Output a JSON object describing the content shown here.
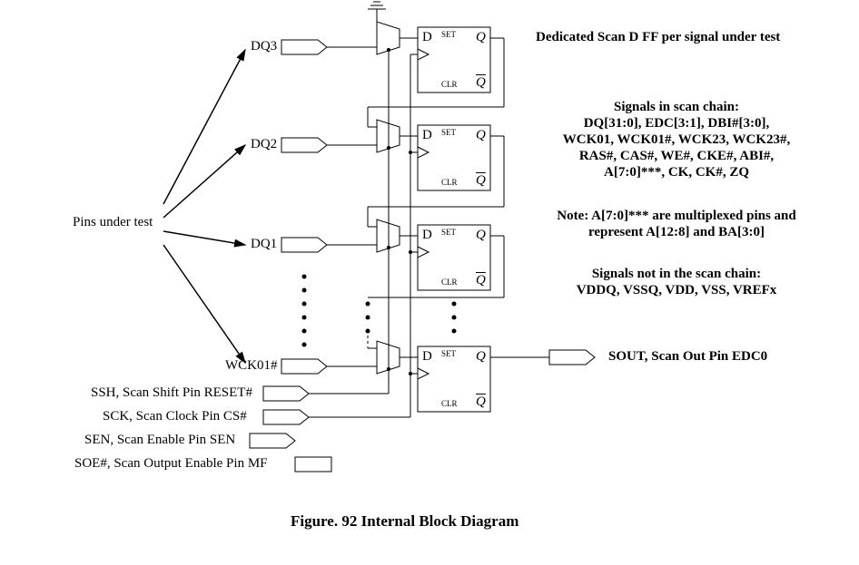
{
  "pins": {
    "dq3": "DQ3",
    "dq2": "DQ2",
    "dq1": "DQ1",
    "wck01": "WCK01#"
  },
  "left_label": "Pins under test",
  "ff": {
    "d": "D",
    "set": "SET",
    "q": "Q",
    "clr": "CLR",
    "qbar": "Q"
  },
  "right": {
    "title1": "Dedicated Scan D FF per signal under test",
    "title2": "Signals in scan chain:",
    "line1": "DQ[31:0], EDC[3:1], DBI#[3:0],",
    "line2": "WCK01, WCK01#, WCK23, WCK23#,",
    "line3": "RAS#, CAS#, WE#, CKE#, ABI#,",
    "line4": "A[7:0]***, CK, CK#, ZQ",
    "note1": "Note: A[7:0]*** are multiplexed pins and",
    "note2": "represent A[12:8] and BA[3:0]",
    "title3": "Signals not in the scan chain:",
    "line5": "VDDQ, VSSQ, VDD, VSS, VREFx",
    "sout": "SOUT, Scan Out Pin EDC0"
  },
  "ctrl": {
    "ssh": "SSH, Scan Shift Pin RESET#",
    "sck": "SCK, Scan Clock Pin CS#",
    "sen": "SEN, Scan Enable Pin SEN",
    "soe": "SOE#, Scan Output Enable Pin MF"
  },
  "caption": "Figure. 92 Internal Block Diagram"
}
